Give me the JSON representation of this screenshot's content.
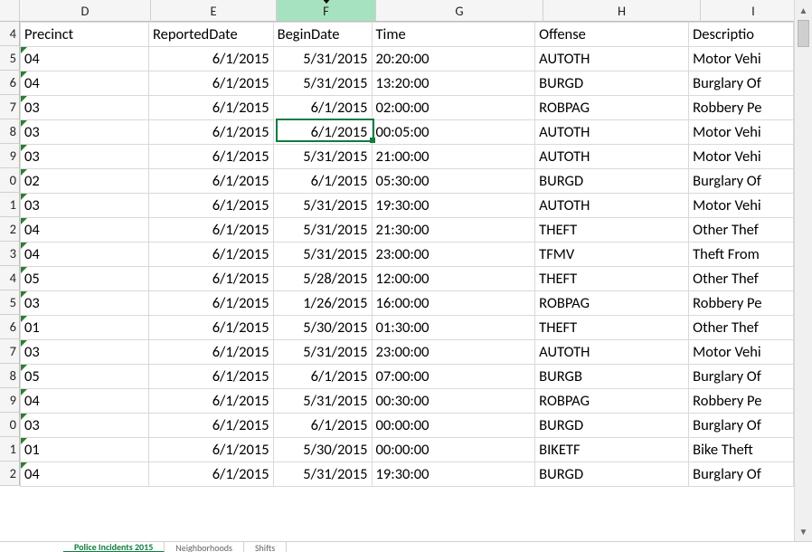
{
  "columns": [
    {
      "id": "D",
      "label": "D",
      "width": 145,
      "align": "left",
      "header": "Precinct"
    },
    {
      "id": "E",
      "label": "E",
      "width": 139,
      "align": "right",
      "header": "ReportedDate"
    },
    {
      "id": "F",
      "label": "F",
      "width": 110,
      "align": "right",
      "header": "BeginDate",
      "selected": true
    },
    {
      "id": "G",
      "label": "G",
      "width": 185,
      "align": "left",
      "header": "Time"
    },
    {
      "id": "H",
      "label": "H",
      "width": 174,
      "align": "left",
      "header": "Offense"
    },
    {
      "id": "I",
      "label": "I",
      "width": 117,
      "align": "left",
      "header": "Descriptio"
    }
  ],
  "row_numbers": [
    "4",
    "5",
    "6",
    "7",
    "8",
    "9",
    "0",
    "1",
    "2",
    "3",
    "4",
    "5",
    "6",
    "7",
    "8",
    "9",
    "0",
    "1",
    "2"
  ],
  "header_row": [
    "Precinct",
    "ReportedDate",
    "BeginDate",
    "Time",
    "Offense",
    "Descriptio"
  ],
  "rows": [
    {
      "precinct": "04",
      "reported": "6/1/2015",
      "begin": "5/31/2015",
      "time": "20:20:00",
      "offense": "AUTOTH",
      "desc": "Motor Vehi"
    },
    {
      "precinct": "04",
      "reported": "6/1/2015",
      "begin": "5/31/2015",
      "time": "13:20:00",
      "offense": "BURGD",
      "desc": "Burglary Of"
    },
    {
      "precinct": "03",
      "reported": "6/1/2015",
      "begin": "6/1/2015",
      "time": "02:00:00",
      "offense": "ROBPAG",
      "desc": "Robbery Pe"
    },
    {
      "precinct": "03",
      "reported": "6/1/2015",
      "begin": "6/1/2015",
      "time": "00:05:00",
      "offense": "AUTOTH",
      "desc": "Motor Vehi"
    },
    {
      "precinct": "03",
      "reported": "6/1/2015",
      "begin": "5/31/2015",
      "time": "21:00:00",
      "offense": "AUTOTH",
      "desc": "Motor Vehi"
    },
    {
      "precinct": "02",
      "reported": "6/1/2015",
      "begin": "6/1/2015",
      "time": "05:30:00",
      "offense": "BURGD",
      "desc": "Burglary Of"
    },
    {
      "precinct": "03",
      "reported": "6/1/2015",
      "begin": "5/31/2015",
      "time": "19:30:00",
      "offense": "AUTOTH",
      "desc": "Motor Vehi"
    },
    {
      "precinct": "04",
      "reported": "6/1/2015",
      "begin": "5/31/2015",
      "time": "21:30:00",
      "offense": "THEFT",
      "desc": "Other Thef"
    },
    {
      "precinct": "04",
      "reported": "6/1/2015",
      "begin": "5/31/2015",
      "time": "23:00:00",
      "offense": "TFMV",
      "desc": "Theft From"
    },
    {
      "precinct": "05",
      "reported": "6/1/2015",
      "begin": "5/28/2015",
      "time": "12:00:00",
      "offense": "THEFT",
      "desc": "Other Thef"
    },
    {
      "precinct": "03",
      "reported": "6/1/2015",
      "begin": "1/26/2015",
      "time": "16:00:00",
      "offense": "ROBPAG",
      "desc": "Robbery Pe"
    },
    {
      "precinct": "01",
      "reported": "6/1/2015",
      "begin": "5/30/2015",
      "time": "01:30:00",
      "offense": "THEFT",
      "desc": "Other Thef"
    },
    {
      "precinct": "03",
      "reported": "6/1/2015",
      "begin": "5/31/2015",
      "time": "23:00:00",
      "offense": "AUTOTH",
      "desc": "Motor Vehi"
    },
    {
      "precinct": "05",
      "reported": "6/1/2015",
      "begin": "6/1/2015",
      "time": "07:00:00",
      "offense": "BURGB",
      "desc": "Burglary Of"
    },
    {
      "precinct": "04",
      "reported": "6/1/2015",
      "begin": "5/31/2015",
      "time": "00:30:00",
      "offense": "ROBPAG",
      "desc": "Robbery Pe"
    },
    {
      "precinct": "03",
      "reported": "6/1/2015",
      "begin": "6/1/2015",
      "time": "00:00:00",
      "offense": "BURGD",
      "desc": "Burglary Of"
    },
    {
      "precinct": "01",
      "reported": "6/1/2015",
      "begin": "5/30/2015",
      "time": "00:00:00",
      "offense": "BIKETF",
      "desc": "Bike Theft"
    },
    {
      "precinct": "04",
      "reported": "6/1/2015",
      "begin": "5/31/2015",
      "time": "19:30:00",
      "offense": "BURGD",
      "desc": "Burglary Of"
    }
  ],
  "selected_cell": {
    "row_index": 3,
    "col_id": "F"
  },
  "tabs": [
    {
      "label": "Police Incidents 2015",
      "active": true
    },
    {
      "label": "Neighborhoods",
      "active": false
    },
    {
      "label": "Shifts",
      "active": false
    }
  ],
  "icons": {
    "up": "▲",
    "down": "▼"
  }
}
